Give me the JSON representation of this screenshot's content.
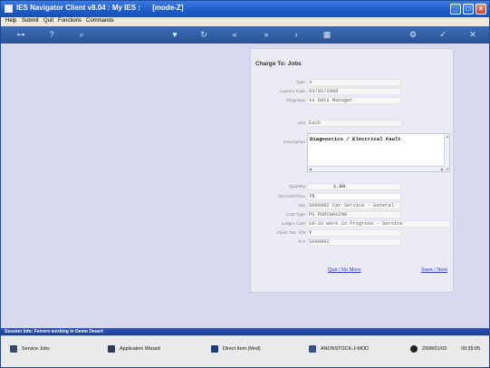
{
  "window": {
    "title": "IES Navigator Client v8.04 : My IES :      [mode-Z]"
  },
  "menu": {
    "items": [
      "Help",
      "Submit",
      "Quit",
      "Functions",
      "Commands"
    ]
  },
  "panel": {
    "title": "Charge To: Jobs",
    "fields": {
      "type": {
        "label": "Type",
        "value": "3"
      },
      "capture_date": {
        "label": "Capture Date",
        "value": "03/01/2008"
      },
      "originator": {
        "label": "Originator",
        "value": "ta Data Manager"
      },
      "unit": {
        "label": "Unit",
        "value": "Each"
      },
      "description": {
        "label": "Description",
        "value": "Diagnostics / Electrical Fault"
      },
      "quantity": {
        "label": "Quantity",
        "value": "1.00"
      },
      "incl_unit_price": {
        "label": "Incl Unit Price",
        "value": "75"
      },
      "job": {
        "label": "Job",
        "value": "S000002 Car Service - General"
      },
      "cost_type": {
        "label": "Cost Type",
        "value": "PU PURCHASING"
      },
      "ledger_cat": {
        "label": "Ledger Cat#",
        "value": "18-32 Work in Progress - Service"
      },
      "claim_tax": {
        "label": "Claim Tax: Y/N",
        "value": "Y"
      },
      "ref": {
        "label": "R #",
        "value": "S000002"
      }
    },
    "quit_link": "Quit / No More",
    "save_link": "Save / Next"
  },
  "status": {
    "text": "Session Info: Ferrero working in Demo Desert"
  },
  "taskbar": {
    "items": [
      "Service Jobs",
      "Application Wizard",
      "Direct Item (Mod)",
      "ANONSTOCK-J-MOD"
    ],
    "date": "2008/01/03",
    "time": "00:39:05"
  },
  "colors": {
    "title_bar": "#1f5bc8",
    "toolbar": "#2a5294",
    "workspace": "#d6d9ef",
    "link": "#2a3fd0"
  }
}
